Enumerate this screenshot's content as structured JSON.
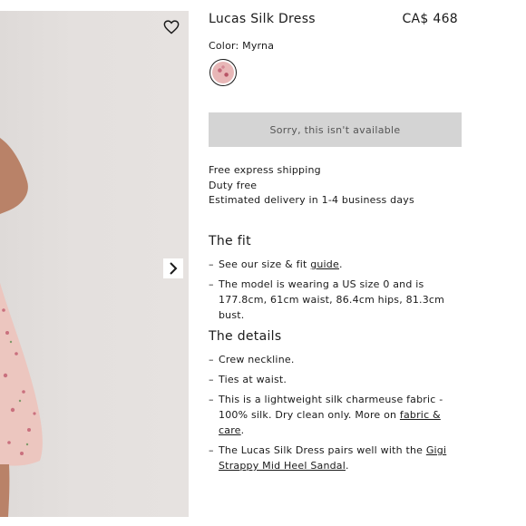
{
  "product": {
    "title": "Lucas Silk Dress",
    "price": "CA$ 468",
    "color_label": "Color: Myrna",
    "unavailable_label": "Sorry, this isn't available"
  },
  "shipping": [
    "Free express shipping",
    "Duty free",
    "Estimated delivery in 1-4 business days"
  ],
  "fit": {
    "heading": "The fit",
    "item1_prefix": "See our size & fit ",
    "item1_link": "guide",
    "item1_suffix": ".",
    "item2": "The model is wearing a US size 0 and is 177.8cm, 61cm waist, 86.4cm hips, 81.3cm bust."
  },
  "details": {
    "heading": "The details",
    "item1": "Crew neckline.",
    "item2": "Ties at waist.",
    "item3_prefix": "This is a lightweight silk charmeuse fabric - 100% silk. Dry clean only. More on ",
    "item3_link": "fabric & care",
    "item3_suffix": ".",
    "item4_prefix": "The Lucas Silk Dress pairs well with the ",
    "item4_link": "Gigi Strappy Mid Heel Sandal",
    "item4_suffix": "."
  },
  "dash": "–",
  "icons": {
    "wishlist": "heart-icon",
    "next": "chevron-right-icon"
  },
  "colors": {
    "unavailable_bg": "#d4d4d4",
    "photo_bg": "#e2dedc",
    "dress": "#ecc6bf"
  }
}
